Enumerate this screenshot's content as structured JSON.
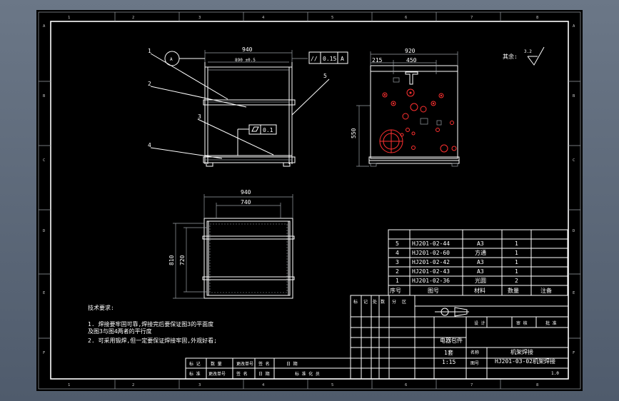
{
  "border": {
    "top_zones": [
      "1",
      "2",
      "3",
      "4",
      "5",
      "6",
      "7",
      "8"
    ],
    "side_zones": [
      "A",
      "B",
      "C",
      "D",
      "E",
      "F"
    ]
  },
  "leaders": [
    "1",
    "2",
    "3",
    "4",
    "5"
  ],
  "datum": "A",
  "front_view": {
    "dims": {
      "overall": "940",
      "inner": "890 ±0.5",
      "flatness": "0.1"
    },
    "parallelism": {
      "symbol": "//",
      "value": "0.15",
      "datum": "A"
    }
  },
  "side_view": {
    "dims": {
      "overall": "920",
      "left": "215",
      "mid": "450",
      "height": "550"
    }
  },
  "top_view": {
    "dims": {
      "overall": "940",
      "inner": "740",
      "depth": "810",
      "inner_depth": "720"
    }
  },
  "roughness": {
    "label": "其余:",
    "value": "3.2"
  },
  "notes": {
    "title": "技术要求:",
    "lines": [
      "1. 焊接要牢固可靠,焊接完后要保证图3的平面度",
      "   及图3与图4两者的平行度",
      "2. 可采用锻焊,但一定要保证焊接牢固,外观好看;"
    ]
  },
  "bom": {
    "headers": [
      "序号",
      "图号",
      "材料",
      "数量",
      "注备"
    ],
    "rows": [
      [
        "5",
        "HJ201-02-44",
        "A3",
        "1",
        ""
      ],
      [
        "4",
        "HJ201-02-60",
        "方通",
        "1",
        ""
      ],
      [
        "3",
        "HJ201-02-42",
        "A3",
        "1",
        ""
      ],
      [
        "2",
        "HJ201-02-43",
        "A3",
        "1",
        ""
      ],
      [
        "1",
        "HJ201-02-36",
        "光圆",
        "2",
        ""
      ]
    ]
  },
  "title_block": {
    "material": "电器包件",
    "design_labels": [
      "设 计",
      "审 核",
      "批 准"
    ],
    "qty_label": "1套",
    "scale": "1:15",
    "name_label": "名称",
    "drawing_no_label": "图号",
    "product": "机架焊接",
    "drawing_no": "HJ201-03-02机架焊接",
    "sheet": "1.0",
    "rev_headers": [
      "标 记",
      "数 量",
      "更改单号",
      "签 名",
      "日 期"
    ],
    "rev_footer": [
      "标 准",
      "更改单号",
      "签 名",
      "日 期",
      "标 准 化 员"
    ],
    "rev_marks": [
      "标",
      "记",
      "处",
      "数",
      "分",
      "区"
    ]
  }
}
